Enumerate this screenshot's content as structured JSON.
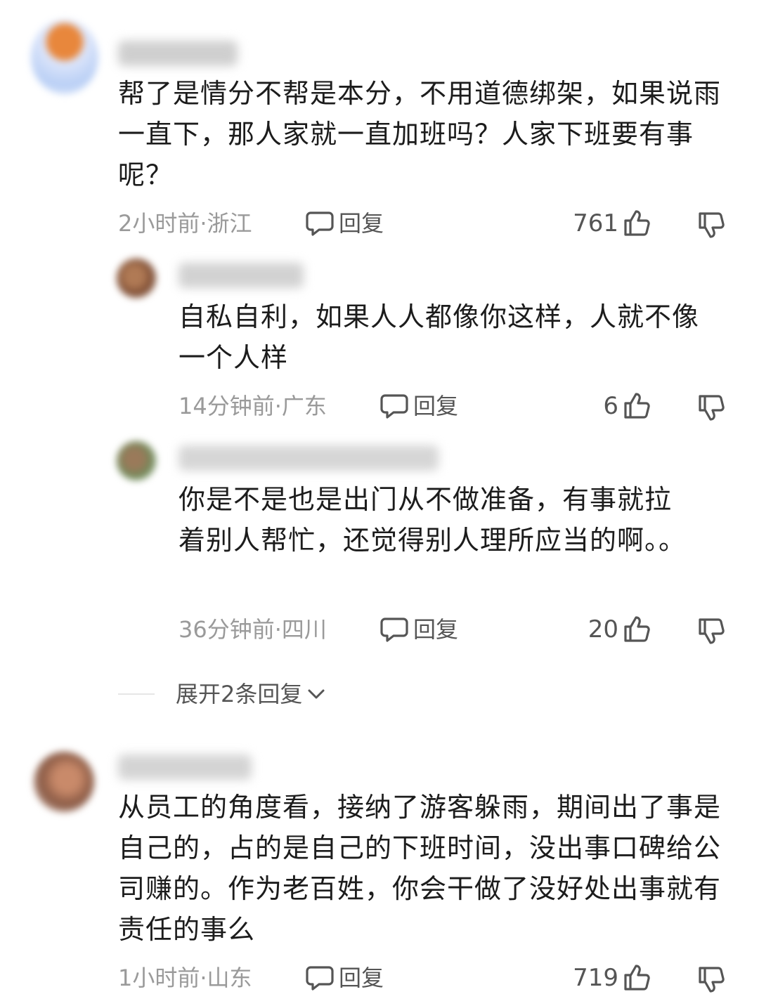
{
  "comments": [
    {
      "text": "帮了是情分不帮是本分，不用道德绑架，如果说雨一直下，那人家就一直加班吗？人家下班要有事呢？",
      "meta": "2小时前·浙江",
      "reply_label": "回复",
      "likes": "761"
    },
    {
      "text": "自私自利，如果人人都像你这样，人就不像一个人样",
      "meta": "14分钟前·广东",
      "reply_label": "回复",
      "likes": "6"
    },
    {
      "text": "你是不是也是出门从不做准备，有事就拉着别人帮忙，还觉得别人理所应当的啊。。",
      "meta": "36分钟前·四川",
      "reply_label": "回复",
      "likes": "20"
    },
    {
      "text": "从员工的角度看，接纳了游客躲雨，期间出了事是自己的，占的是自己的下班时间，没出事口碑给公司赚的。作为老百姓，你会干做了没好处出事就有责任的事么",
      "meta": "1小时前·山东",
      "reply_label": "回复",
      "likes": "719"
    }
  ],
  "expand_replies_label": "展开2条回复",
  "icons": [
    "comment-bubble-icon",
    "thumb-up-icon",
    "thumb-down-icon",
    "chevron-down-icon"
  ],
  "colors": {
    "meta_gray": "#9a9a9a",
    "action_gray": "#555555",
    "text": "#1c1c1c"
  }
}
